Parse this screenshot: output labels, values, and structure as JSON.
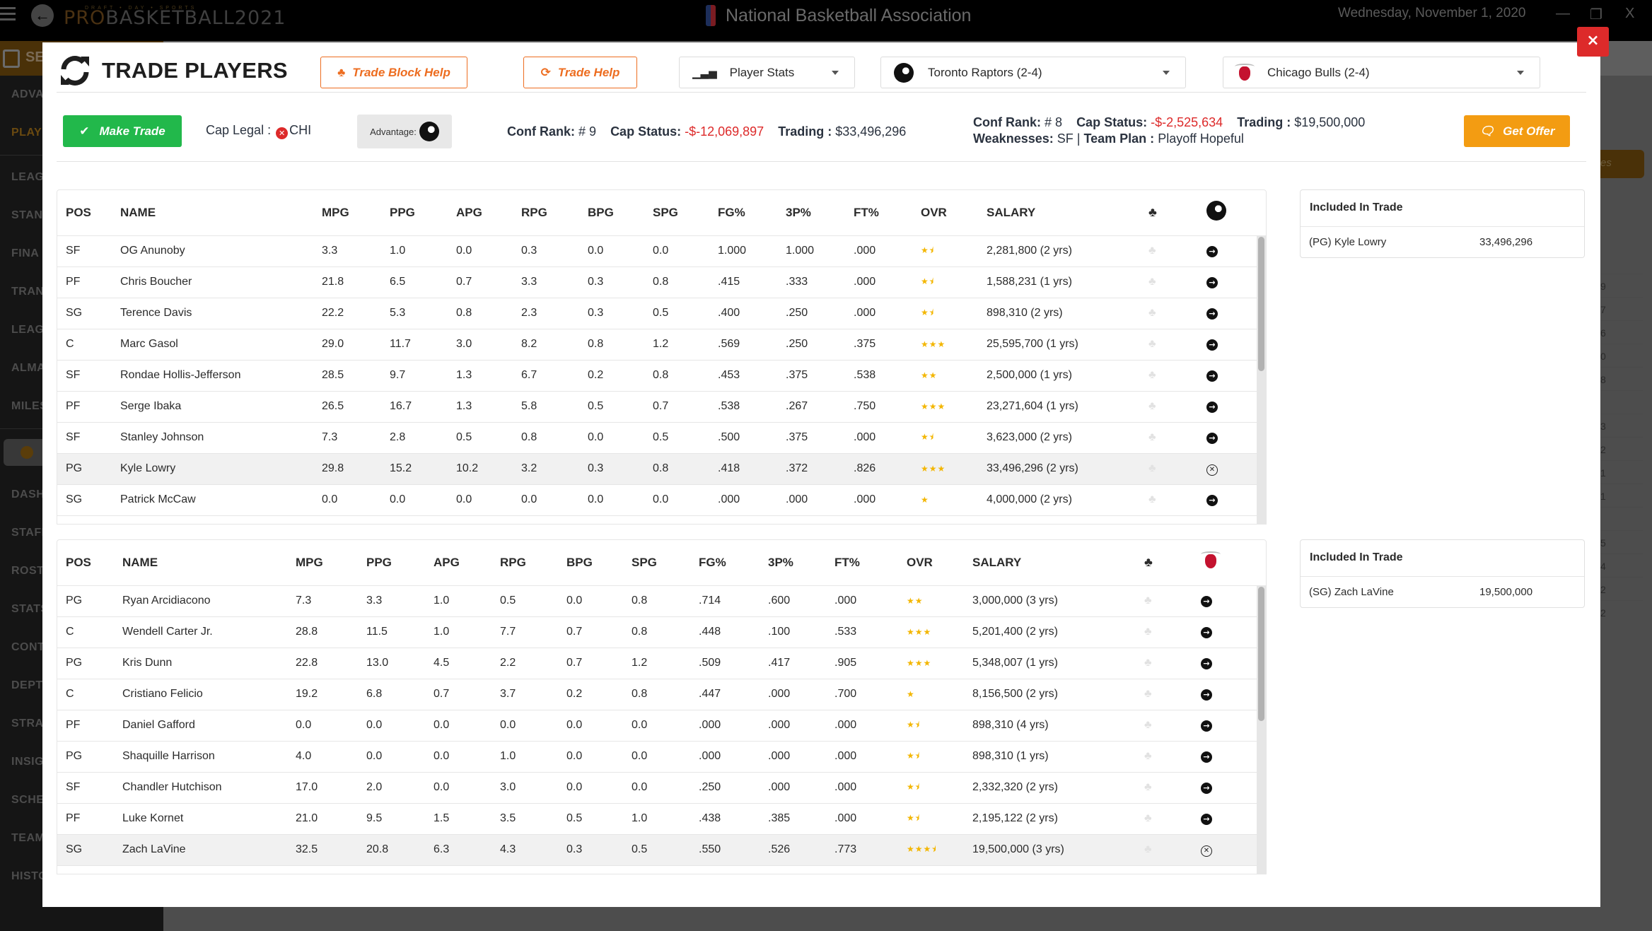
{
  "app": {
    "brand_sub": "DRAFT • DAY • SPORTS",
    "brand_main_a": "PRO",
    "brand_main_b": "BASKETBALL2021",
    "league_name": "National Basketball Association",
    "date": "Wednesday, November 1, 2020",
    "window_controls": {
      "minimize": "—",
      "maximize": "❐",
      "close": "X"
    }
  },
  "sidebar": {
    "season_label": "SE",
    "items_top": [
      {
        "label": "ADVA",
        "active": false
      },
      {
        "label": "PLAY",
        "active": true
      }
    ],
    "items_mid": [
      "LEAG",
      "STAN",
      "FINA",
      "TRAN",
      "LEAG",
      "ALMA",
      "MILES"
    ],
    "items_bottom": [
      "DASH",
      "STAFF",
      "ROST",
      "STATS",
      "CONT",
      "DEPT",
      "STRAT",
      "INSIG",
      "SCHE",
      "TEAM",
      "HISTORY"
    ]
  },
  "background_right": {
    "button_label": "es",
    "numbers": [
      "9",
      "7",
      "6",
      "0",
      "8",
      "",
      "3",
      "2",
      "1",
      "1",
      "",
      "5",
      "4",
      "2",
      "2"
    ]
  },
  "modal": {
    "title": "TRADE PLAYERS",
    "close_label": "×",
    "trade_block_help": "Trade Block Help",
    "trade_help": "Trade Help",
    "view_select": {
      "selected": "Player Stats",
      "icon": "bar-chart-icon"
    },
    "team_left_select": {
      "selected": "Toronto Raptors (2-4)",
      "icon": "raptors-logo"
    },
    "team_right_select": {
      "selected": "Chicago Bulls (2-4)",
      "icon": "bulls-logo"
    },
    "make_trade": "Make Trade",
    "cap_legal_label": "Cap Legal :",
    "cap_legal_status": "illegal",
    "cap_legal_team": "CHI",
    "advantage_label": "Advantage:",
    "advantage_team": "Toronto Raptors",
    "left_team_info": {
      "conf_rank_label": "Conf Rank:",
      "conf_rank": "# 9",
      "cap_status_label": "Cap Status:",
      "cap_status": "-$-12,069,897",
      "trading_label": "Trading :",
      "trading": "$33,496,296"
    },
    "right_team_info": {
      "conf_rank_label": "Conf Rank:",
      "conf_rank": "# 8",
      "cap_status_label": "Cap Status:",
      "cap_status": "-$-2,525,634",
      "trading_label": "Trading :",
      "trading": "$19,500,000",
      "weaknesses_label": "Weaknesses:",
      "weaknesses": "SF",
      "team_plan_label": "Team Plan :",
      "team_plan": "Playoff Hopeful"
    },
    "get_offer": "Get Offer",
    "colors": {
      "orange": "#ed6d20",
      "green": "#22b84b",
      "gold": "#f39c12",
      "red": "#dd2a2a",
      "star": "#f3b600"
    }
  },
  "columns": [
    "POS",
    "NAME",
    "MPG",
    "PPG",
    "APG",
    "RPG",
    "BPG",
    "SPG",
    "FG%",
    "3P%",
    "FT%",
    "OVR",
    "SALARY"
  ],
  "raptors": {
    "rows": [
      {
        "pos": "SF",
        "name": "OG Anunoby",
        "mpg": "3.3",
        "ppg": "1.0",
        "apg": "0.0",
        "rpg": "0.3",
        "bpg": "0.0",
        "spg": "0.0",
        "fg": "1.000",
        "tp": "1.000",
        "ft": ".000",
        "ovr": 1.5,
        "salary": "2,281,800 (2 yrs)",
        "in_trade": false
      },
      {
        "pos": "PF",
        "name": "Chris Boucher",
        "mpg": "21.8",
        "ppg": "6.5",
        "apg": "0.7",
        "rpg": "3.3",
        "bpg": "0.3",
        "spg": "0.8",
        "fg": ".415",
        "tp": ".333",
        "ft": ".000",
        "ovr": 1.5,
        "salary": "1,588,231 (1 yrs)",
        "in_trade": false
      },
      {
        "pos": "SG",
        "name": "Terence Davis",
        "mpg": "22.2",
        "ppg": "5.3",
        "apg": "0.8",
        "rpg": "2.3",
        "bpg": "0.3",
        "spg": "0.5",
        "fg": ".400",
        "tp": ".250",
        "ft": ".000",
        "ovr": 1.5,
        "salary": "898,310 (2 yrs)",
        "in_trade": false
      },
      {
        "pos": "C",
        "name": "Marc Gasol",
        "mpg": "29.0",
        "ppg": "11.7",
        "apg": "3.0",
        "rpg": "8.2",
        "bpg": "0.8",
        "spg": "1.2",
        "fg": ".569",
        "tp": ".250",
        "ft": ".375",
        "ovr": 3,
        "salary": "25,595,700 (1 yrs)",
        "in_trade": false
      },
      {
        "pos": "SF",
        "name": "Rondae Hollis-Jefferson",
        "mpg": "28.5",
        "ppg": "9.7",
        "apg": "1.3",
        "rpg": "6.7",
        "bpg": "0.2",
        "spg": "0.8",
        "fg": ".453",
        "tp": ".375",
        "ft": ".538",
        "ovr": 2,
        "salary": "2,500,000 (1 yrs)",
        "in_trade": false
      },
      {
        "pos": "PF",
        "name": "Serge Ibaka",
        "mpg": "26.5",
        "ppg": "16.7",
        "apg": "1.3",
        "rpg": "5.8",
        "bpg": "0.5",
        "spg": "0.7",
        "fg": ".538",
        "tp": ".267",
        "ft": ".750",
        "ovr": 3,
        "salary": "23,271,604 (1 yrs)",
        "in_trade": false
      },
      {
        "pos": "SF",
        "name": "Stanley Johnson",
        "mpg": "7.3",
        "ppg": "2.8",
        "apg": "0.5",
        "rpg": "0.8",
        "bpg": "0.0",
        "spg": "0.5",
        "fg": ".500",
        "tp": ".375",
        "ft": ".000",
        "ovr": 1.5,
        "salary": "3,623,000 (2 yrs)",
        "in_trade": false
      },
      {
        "pos": "PG",
        "name": "Kyle Lowry",
        "mpg": "29.8",
        "ppg": "15.2",
        "apg": "10.2",
        "rpg": "3.2",
        "bpg": "0.3",
        "spg": "0.8",
        "fg": ".418",
        "tp": ".372",
        "ft": ".826",
        "ovr": 3,
        "salary": "33,496,296 (2 yrs)",
        "in_trade": true
      },
      {
        "pos": "SG",
        "name": "Patrick McCaw",
        "mpg": "0.0",
        "ppg": "0.0",
        "apg": "0.0",
        "rpg": "0.0",
        "bpg": "0.0",
        "spg": "0.0",
        "fg": ".000",
        "tp": ".000",
        "ft": ".000",
        "ovr": 1,
        "salary": "4,000,000 (2 yrs)",
        "in_trade": false
      }
    ],
    "scroll_fraction": 0.0,
    "included": {
      "title": "Included In Trade",
      "items": [
        {
          "name": "(PG) Kyle Lowry",
          "salary": "33,496,296"
        }
      ]
    }
  },
  "bulls": {
    "rows": [
      {
        "pos": "PG",
        "name": "Ryan Arcidiacono",
        "mpg": "7.3",
        "ppg": "3.3",
        "apg": "1.0",
        "rpg": "0.5",
        "bpg": "0.0",
        "spg": "0.8",
        "fg": ".714",
        "tp": ".600",
        "ft": ".000",
        "ovr": 2,
        "salary": "3,000,000 (3 yrs)",
        "in_trade": false
      },
      {
        "pos": "C",
        "name": "Wendell Carter Jr.",
        "mpg": "28.8",
        "ppg": "11.5",
        "apg": "1.0",
        "rpg": "7.7",
        "bpg": "0.7",
        "spg": "0.8",
        "fg": ".448",
        "tp": ".100",
        "ft": ".533",
        "ovr": 3,
        "salary": "5,201,400 (2 yrs)",
        "in_trade": false
      },
      {
        "pos": "PG",
        "name": "Kris Dunn",
        "mpg": "22.8",
        "ppg": "13.0",
        "apg": "4.5",
        "rpg": "2.2",
        "bpg": "0.7",
        "spg": "1.2",
        "fg": ".509",
        "tp": ".417",
        "ft": ".905",
        "ovr": 3,
        "salary": "5,348,007 (1 yrs)",
        "in_trade": false
      },
      {
        "pos": "C",
        "name": "Cristiano Felicio",
        "mpg": "19.2",
        "ppg": "6.8",
        "apg": "0.7",
        "rpg": "3.7",
        "bpg": "0.2",
        "spg": "0.8",
        "fg": ".447",
        "tp": ".000",
        "ft": ".700",
        "ovr": 1,
        "salary": "8,156,500 (2 yrs)",
        "in_trade": false
      },
      {
        "pos": "PF",
        "name": "Daniel Gafford",
        "mpg": "0.0",
        "ppg": "0.0",
        "apg": "0.0",
        "rpg": "0.0",
        "bpg": "0.0",
        "spg": "0.0",
        "fg": ".000",
        "tp": ".000",
        "ft": ".000",
        "ovr": 1.5,
        "salary": "898,310 (4 yrs)",
        "in_trade": false
      },
      {
        "pos": "PG",
        "name": "Shaquille Harrison",
        "mpg": "4.0",
        "ppg": "0.0",
        "apg": "0.0",
        "rpg": "1.0",
        "bpg": "0.0",
        "spg": "0.0",
        "fg": ".000",
        "tp": ".000",
        "ft": ".000",
        "ovr": 1.5,
        "salary": "898,310 (1 yrs)",
        "in_trade": false
      },
      {
        "pos": "SF",
        "name": "Chandler Hutchison",
        "mpg": "17.0",
        "ppg": "2.0",
        "apg": "0.0",
        "rpg": "3.0",
        "bpg": "0.0",
        "spg": "0.0",
        "fg": ".250",
        "tp": ".000",
        "ft": ".000",
        "ovr": 1.5,
        "salary": "2,332,320 (2 yrs)",
        "in_trade": false
      },
      {
        "pos": "PF",
        "name": "Luke Kornet",
        "mpg": "21.0",
        "ppg": "9.5",
        "apg": "1.5",
        "rpg": "3.5",
        "bpg": "0.5",
        "spg": "1.0",
        "fg": ".438",
        "tp": ".385",
        "ft": ".000",
        "ovr": 1.5,
        "salary": "2,195,122 (2 yrs)",
        "in_trade": false
      },
      {
        "pos": "SG",
        "name": "Zach LaVine",
        "mpg": "32.5",
        "ppg": "20.8",
        "apg": "6.3",
        "rpg": "4.3",
        "bpg": "0.3",
        "spg": "0.5",
        "fg": ".550",
        "tp": ".526",
        "ft": ".773",
        "ovr": 3.5,
        "salary": "19,500,000 (3 yrs)",
        "in_trade": true
      }
    ],
    "scroll_fraction": 0.0,
    "included": {
      "title": "Included In Trade",
      "items": [
        {
          "name": "(SG) Zach LaVine",
          "salary": "19,500,000"
        }
      ]
    }
  }
}
